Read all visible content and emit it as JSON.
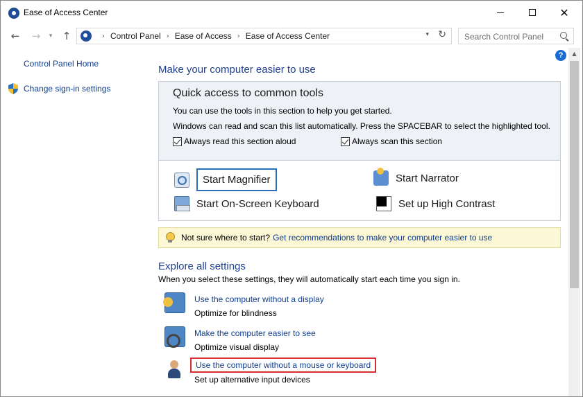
{
  "window": {
    "title": "Ease of Access Center",
    "controls": {
      "minimize": "minimize",
      "maximize": "maximize",
      "close": "✕"
    }
  },
  "address": {
    "breadcrumbs": [
      "Control Panel",
      "Ease of Access",
      "Ease of Access Center"
    ],
    "search_placeholder": "Search Control Panel"
  },
  "sidebar": {
    "home": "Control Panel Home",
    "signin": "Change sign-in settings"
  },
  "main": {
    "heading": "Make your computer easier to use",
    "help": "?",
    "quick": {
      "title": "Quick access to common tools",
      "line1": "You can use the tools in this section to help you get started.",
      "line2": "Windows can read and scan this list automatically.  Press the SPACEBAR to select the highlighted tool.",
      "checkbox_read": {
        "label": "Always read this section aloud",
        "checked": true
      },
      "checkbox_scan": {
        "label": "Always scan this section",
        "checked": true
      },
      "tools": {
        "magnifier": "Start Magnifier",
        "narrator": "Start Narrator",
        "osk": "Start On-Screen Keyboard",
        "contrast": "Set up High Contrast"
      }
    },
    "tip": {
      "question": "Not sure where to start?",
      "link": "Get recommendations to make your computer easier to use"
    },
    "explore": {
      "heading": "Explore all settings",
      "subtitle": "When you select these settings, they will automatically start each time you sign in.",
      "items": [
        {
          "link": "Use the computer without a display",
          "sub": "Optimize for blindness"
        },
        {
          "link": "Make the computer easier to see",
          "sub": "Optimize visual display"
        },
        {
          "link": "Use the computer without a mouse or keyboard",
          "sub": "Set up alternative input devices"
        }
      ]
    }
  },
  "colors": {
    "link": "#0e3d8f",
    "heading": "#1e3f8c",
    "highlight_border": "#d32f2f",
    "tip_bg": "#fcf8d5"
  }
}
